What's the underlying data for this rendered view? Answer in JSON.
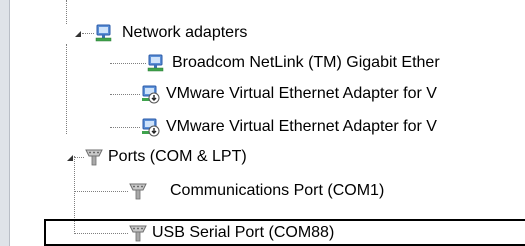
{
  "tree": {
    "network_adapters": {
      "label": "Network adapters",
      "icon": "network-adapter-icon",
      "children": [
        {
          "label": "Broadcom NetLink (TM) Gigabit Ether",
          "icon": "network-adapter-icon"
        },
        {
          "label": "VMware Virtual Ethernet Adapter for V",
          "icon": "vmware-adapter-icon"
        },
        {
          "label": "VMware Virtual Ethernet Adapter for V",
          "icon": "vmware-adapter-icon"
        }
      ]
    },
    "ports": {
      "label": "Ports (COM & LPT)",
      "icon": "port-icon",
      "children": [
        {
          "label": "Communications Port (COM1)",
          "icon": "port-icon"
        },
        {
          "label": "USB Serial Port (COM88)",
          "icon": "port-icon",
          "highlighted": true
        }
      ]
    }
  }
}
